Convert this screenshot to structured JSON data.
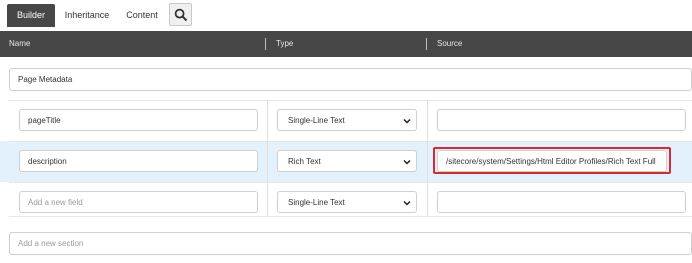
{
  "tabs": [
    {
      "label": "Builder",
      "active": true
    },
    {
      "label": "Inheritance",
      "active": false
    },
    {
      "label": "Content",
      "active": false
    }
  ],
  "search_icon": "search-icon",
  "columns": {
    "name": "Name",
    "type": "Type",
    "source": "Source"
  },
  "section": {
    "name": "Page Metadata"
  },
  "fields": [
    {
      "name": "pageTitle",
      "type": "Single-Line Text",
      "source": ""
    },
    {
      "name": "description",
      "type": "Rich Text",
      "source": "/sitecore/system/Settings/Html Editor Profiles/Rich Text Full"
    }
  ],
  "new_field": {
    "placeholder": "Add a new field",
    "type": "Single-Line Text"
  },
  "new_section": {
    "placeholder": "Add a new section"
  },
  "colors": {
    "header_bg": "#474747",
    "highlight_row": "#e2f1fb",
    "callout_border": "#d9292f"
  }
}
